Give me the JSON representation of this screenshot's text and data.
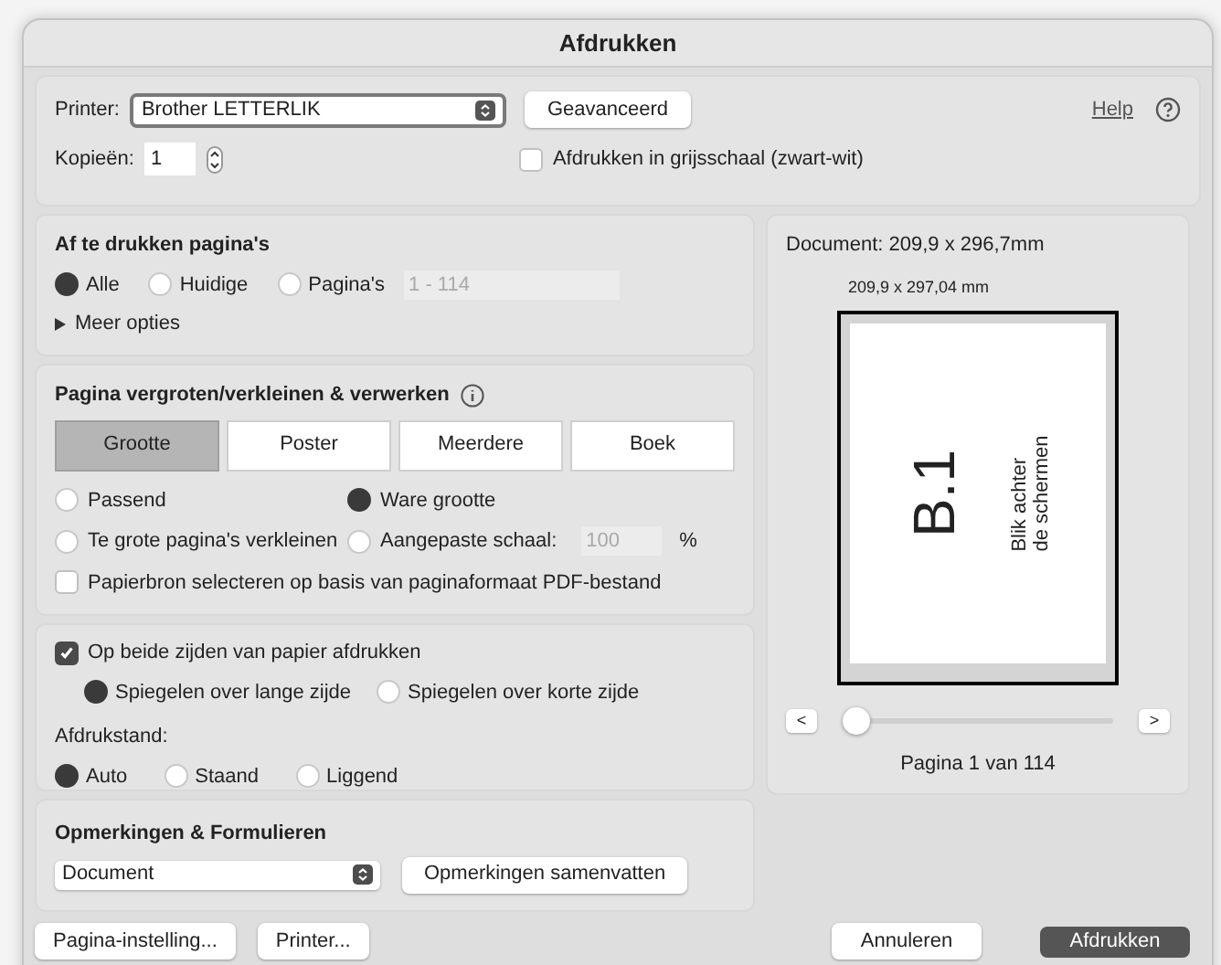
{
  "window": {
    "title": "Afdrukken"
  },
  "printer": {
    "label": "Printer:",
    "value": "Brother LETTERLIK",
    "advanced_button": "Geavanceerd",
    "help_link": "Help"
  },
  "copies": {
    "label": "Kopieën:",
    "value": "1"
  },
  "grayscale": {
    "label": "Afdrukken in grijsschaal (zwart-wit)",
    "checked": false
  },
  "pages": {
    "title": "Af te drukken pagina's",
    "options": [
      {
        "label": "Alle",
        "selected": true
      },
      {
        "label": "Huidige",
        "selected": false
      },
      {
        "label": "Pagina's",
        "selected": false
      }
    ],
    "range_placeholder": "1 - 114",
    "more": "Meer opties"
  },
  "scaling": {
    "title": "Pagina vergroten/verkleinen & verwerken",
    "tabs": [
      {
        "label": "Grootte",
        "selected": true
      },
      {
        "label": "Poster",
        "selected": false
      },
      {
        "label": "Meerdere",
        "selected": false
      },
      {
        "label": "Boek",
        "selected": false
      }
    ],
    "options": [
      {
        "kind": "plain",
        "label": "Passend",
        "selected": false
      },
      {
        "kind": "plain",
        "label": "Ware grootte",
        "selected": true
      },
      {
        "kind": "plain",
        "label": "Te grote pagina's verkleinen",
        "selected": false
      },
      {
        "kind": "custom",
        "label": "Aangepaste schaal:",
        "selected": false,
        "placeholder": "100",
        "unit": "%"
      }
    ],
    "paper_source": {
      "label": "Papierbron selecteren op basis van paginaformaat PDF-bestand",
      "checked": false
    }
  },
  "duplex": {
    "label": "Op beide zijden van papier afdrukken",
    "checked": true,
    "options": [
      {
        "label": "Spiegelen over lange zijde",
        "selected": true
      },
      {
        "label": "Spiegelen over korte zijde",
        "selected": false
      }
    ]
  },
  "orientation": {
    "label": "Afdrukstand:",
    "options": [
      {
        "label": "Auto",
        "selected": true
      },
      {
        "label": "Staand",
        "selected": false
      },
      {
        "label": "Liggend",
        "selected": false
      }
    ]
  },
  "annotations": {
    "title": "Opmerkingen & Formulieren",
    "value": "Document",
    "summarize_button": "Opmerkingen samenvatten"
  },
  "preview": {
    "document_size": "Document: 209,9 x 296,7mm",
    "page_size": "209,9 x 297,04 mm",
    "page_heading": "B.1",
    "page_text": [
      "Blik achter",
      "de schermen"
    ],
    "prev": "<",
    "next": ">",
    "level": 0,
    "page_label": "Pagina 1 van 114"
  },
  "footer": {
    "left": [
      "Pagina-instelling...",
      "Printer..."
    ],
    "cancel": "Annuleren",
    "print": "Afdrukken"
  }
}
